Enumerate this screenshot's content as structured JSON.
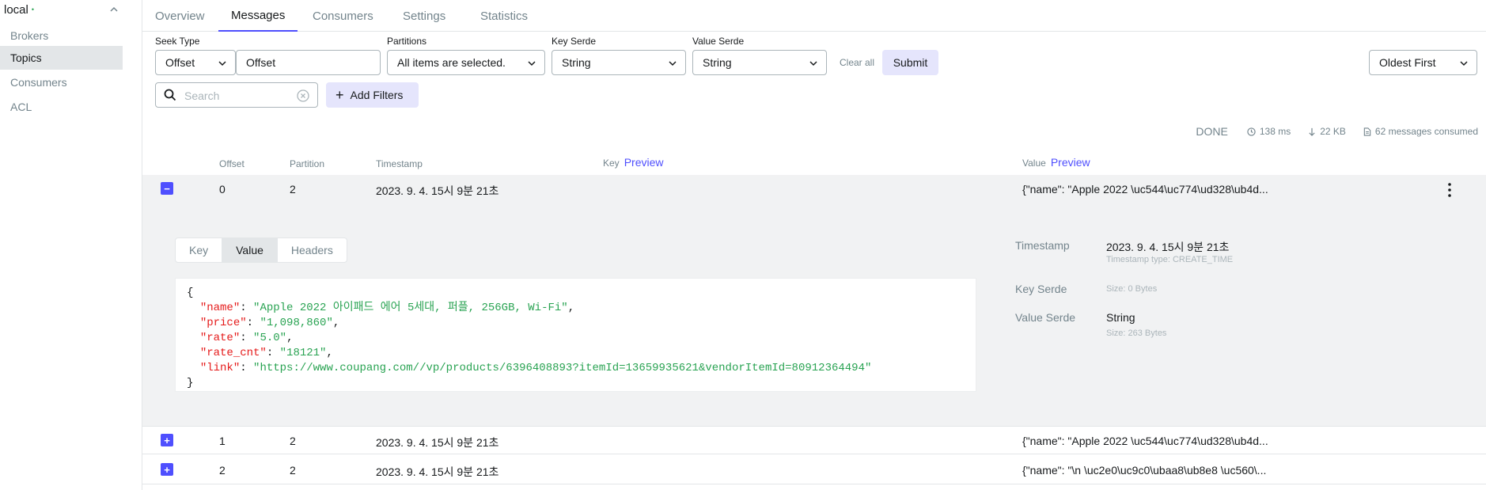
{
  "sidebar": {
    "cluster": "local",
    "cluster_dot": "•",
    "items": [
      {
        "label": "Brokers"
      },
      {
        "label": "Topics"
      },
      {
        "label": "Consumers"
      },
      {
        "label": "ACL"
      }
    ]
  },
  "tabs": [
    {
      "label": "Overview"
    },
    {
      "label": "Messages"
    },
    {
      "label": "Consumers"
    },
    {
      "label": "Settings"
    },
    {
      "label": "Statistics"
    }
  ],
  "filters": {
    "seek_type_label": "Seek Type",
    "seek_type_value": "Offset",
    "offset_value": "Offset",
    "partitions_label": "Partitions",
    "partitions_value": "All items are selected.",
    "key_serde_label": "Key Serde",
    "key_serde_value": "String",
    "value_serde_label": "Value Serde",
    "value_serde_value": "String",
    "clear_all": "Clear all",
    "submit": "Submit",
    "sort_value": "Oldest First",
    "search_placeholder": "Search",
    "add_filters": "Add Filters"
  },
  "stats": {
    "status": "DONE",
    "elapsed": "138 ms",
    "bytes": "22 KB",
    "consumed": "62 messages consumed"
  },
  "table": {
    "headers": {
      "offset": "Offset",
      "partition": "Partition",
      "timestamp": "Timestamp",
      "key": "Key",
      "key_preview": "Preview",
      "value": "Value",
      "value_preview": "Preview"
    },
    "rows": [
      {
        "offset": "0",
        "partition": "2",
        "timestamp": "2023. 9. 4. 15시 9분 21초",
        "value": "{\"name\": \"Apple 2022 \\uc544\\uc774\\ud328\\ub4d...",
        "expanded": true
      },
      {
        "offset": "1",
        "partition": "2",
        "timestamp": "2023. 9. 4. 15시 9분 21초",
        "value": "{\"name\": \"Apple 2022 \\uc544\\uc774\\ud328\\ub4d...",
        "expanded": false
      },
      {
        "offset": "2",
        "partition": "2",
        "timestamp": "2023. 9. 4. 15시 9분 21초",
        "value": "{\"name\": \"\\n \\uc2e0\\uc9c0\\ubaa8\\ub8e8 \\uc560\\...",
        "expanded": false
      }
    ]
  },
  "detail": {
    "subtabs": [
      "Key",
      "Value",
      "Headers"
    ],
    "json": {
      "open": "{",
      "close": "}",
      "lines": [
        {
          "key": "\"name\"",
          "value": "\"Apple 2022 아이패드 에어 5세대, 퍼플, 256GB, Wi-Fi\"",
          "comma": ","
        },
        {
          "key": "\"price\"",
          "value": "\"1,098,860\"",
          "comma": ","
        },
        {
          "key": "\"rate\"",
          "value": "\"5.0\"",
          "comma": ","
        },
        {
          "key": "\"rate_cnt\"",
          "value": "\"18121\"",
          "comma": ","
        },
        {
          "key": "\"link\"",
          "value": "\"https://www.coupang.com//vp/products/6396408893?itemId=13659935621&vendorItemId=80912364494\"",
          "comma": ""
        }
      ]
    },
    "meta": {
      "timestamp_label": "Timestamp",
      "timestamp_value": "2023. 9. 4. 15시 9분 21초",
      "timestamp_type": "Timestamp type: CREATE_TIME",
      "key_serde_label": "Key Serde",
      "key_size": "Size: 0 Bytes",
      "value_serde_label": "Value Serde",
      "value_serde_value": "String",
      "value_size": "Size: 263 Bytes"
    }
  },
  "colors": {
    "accent": "#4f4ffe",
    "status_dot": "#29a352",
    "json_key": "#e51a1a",
    "json_value": "#29a352"
  }
}
